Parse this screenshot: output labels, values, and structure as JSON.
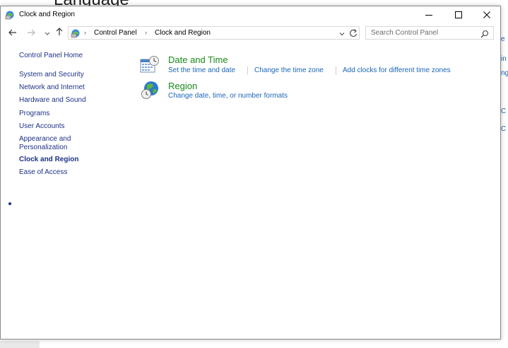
{
  "background": {
    "title": "Language",
    "peek": [
      "e",
      "in",
      "ng",
      "C",
      "C"
    ]
  },
  "window": {
    "title": "Clock and Region",
    "controls": {
      "minimize": "minimize",
      "maximize": "maximize",
      "close": "close"
    }
  },
  "address": {
    "breadcrumbs": [
      "Control Panel",
      "Clock and Region"
    ],
    "search_placeholder": "Search Control Panel"
  },
  "sidebar": {
    "home": "Control Panel Home",
    "items": [
      {
        "label": "System and Security"
      },
      {
        "label": "Network and Internet"
      },
      {
        "label": "Hardware and Sound"
      },
      {
        "label": "Programs"
      },
      {
        "label": "User Accounts"
      },
      {
        "label": "Appearance and Personalization",
        "lines": [
          "Appearance and",
          "Personalization"
        ]
      },
      {
        "label": "Clock and Region",
        "active": true
      },
      {
        "label": "Ease of Access"
      }
    ]
  },
  "categories": [
    {
      "title": "Date and Time",
      "links": [
        "Set the time and date",
        "Change the time zone",
        "Add clocks for different time zones"
      ]
    },
    {
      "title": "Region",
      "links": [
        "Change date, time, or number formats"
      ]
    }
  ],
  "colors": {
    "category_title": "#178a17",
    "link": "#1a65b8",
    "sidebar_link": "#1e3287"
  }
}
